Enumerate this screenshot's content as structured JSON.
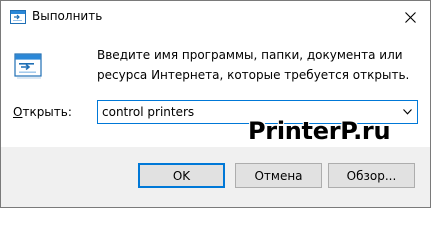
{
  "window": {
    "title": "Выполнить",
    "title_icon": "run-dialog-icon",
    "close_icon": "close-icon"
  },
  "body": {
    "description": "Введите имя программы, папки, документа или ресурса Интернета, которые требуется открыть.",
    "open_label": "Открыть:",
    "open_label_access_key": "О",
    "open_label_rest": "ткрыть:",
    "command_value": "control printers",
    "run_icon": "run-dialog-icon"
  },
  "watermark": {
    "text": "PrinterP.ru"
  },
  "buttons": {
    "ok": "OK",
    "cancel": "Отмена",
    "browse": "Обзор..."
  },
  "colors": {
    "accent": "#0078d7",
    "footer_bg": "#f0f0f0",
    "button_bg": "#e1e1e1",
    "button_border": "#adadad"
  }
}
